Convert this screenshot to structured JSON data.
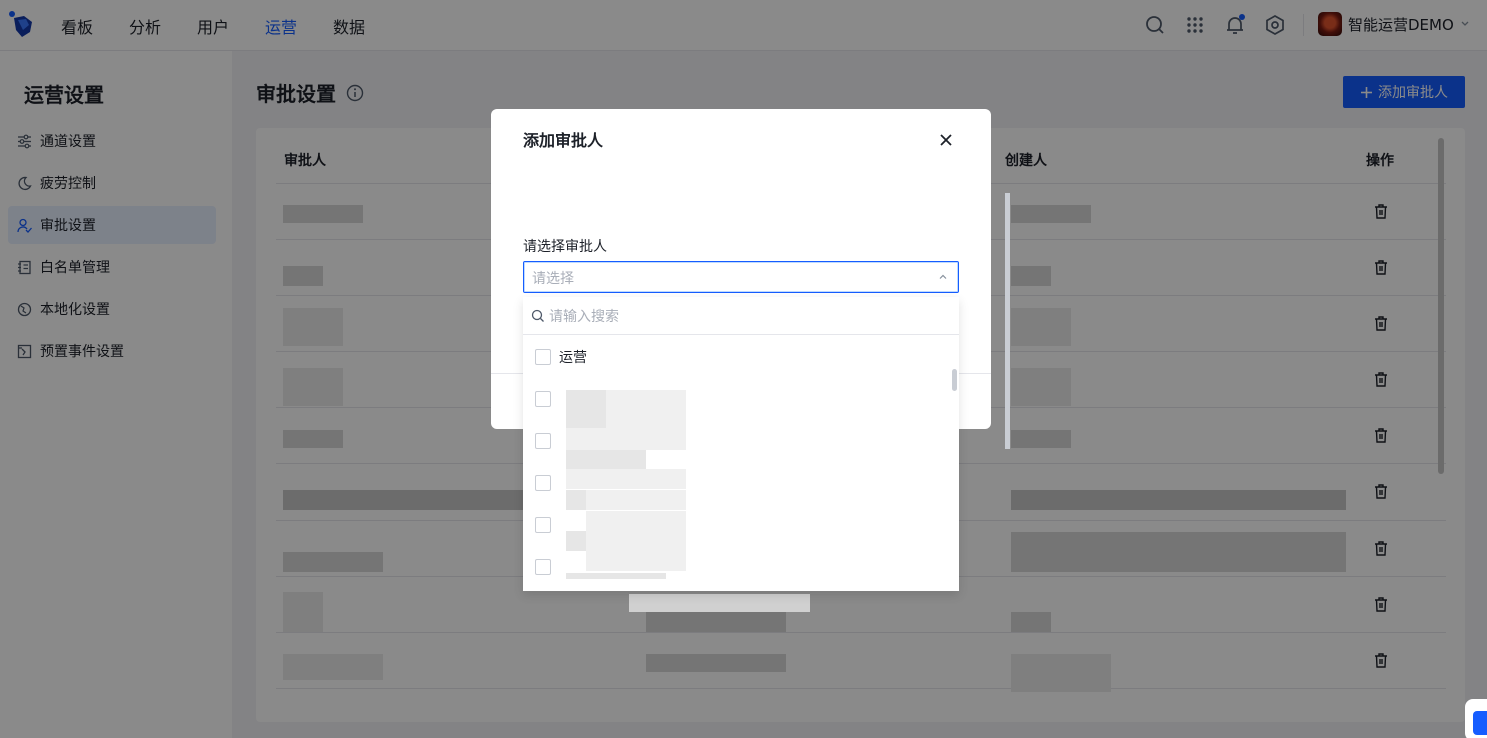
{
  "topnav": {
    "items": [
      "看板",
      "分析",
      "用户",
      "运营",
      "数据"
    ],
    "active": "运营",
    "account_name": "智能运营DEMO",
    "icons": [
      "search-icon",
      "apps-grid-icon",
      "bell-icon",
      "settings-icon",
      "chevron-down-icon"
    ]
  },
  "sidebar": {
    "title": "运营设置",
    "items": [
      {
        "label": "通道设置",
        "icon": "sliders-icon"
      },
      {
        "label": "疲劳控制",
        "icon": "moon-icon"
      },
      {
        "label": "审批设置",
        "icon": "user-check-icon"
      },
      {
        "label": "白名单管理",
        "icon": "list-icon"
      },
      {
        "label": "本地化设置",
        "icon": "globe-icon"
      },
      {
        "label": "预置事件设置",
        "icon": "event-icon"
      }
    ],
    "active": "审批设置"
  },
  "main": {
    "title": "审批设置",
    "add_button": "添加审批人",
    "table": {
      "headers": {
        "approver": "审批人",
        "creator": "创建人",
        "actions": "操作"
      },
      "row_count": 9
    }
  },
  "modal": {
    "title": "添加审批人",
    "field_label": "请选择审批人",
    "select_placeholder": "请选择",
    "search_placeholder": "请输入搜索",
    "options": [
      "运营"
    ]
  },
  "colors": {
    "accent": "#165dff",
    "active_bg": "#e8f0ff"
  }
}
